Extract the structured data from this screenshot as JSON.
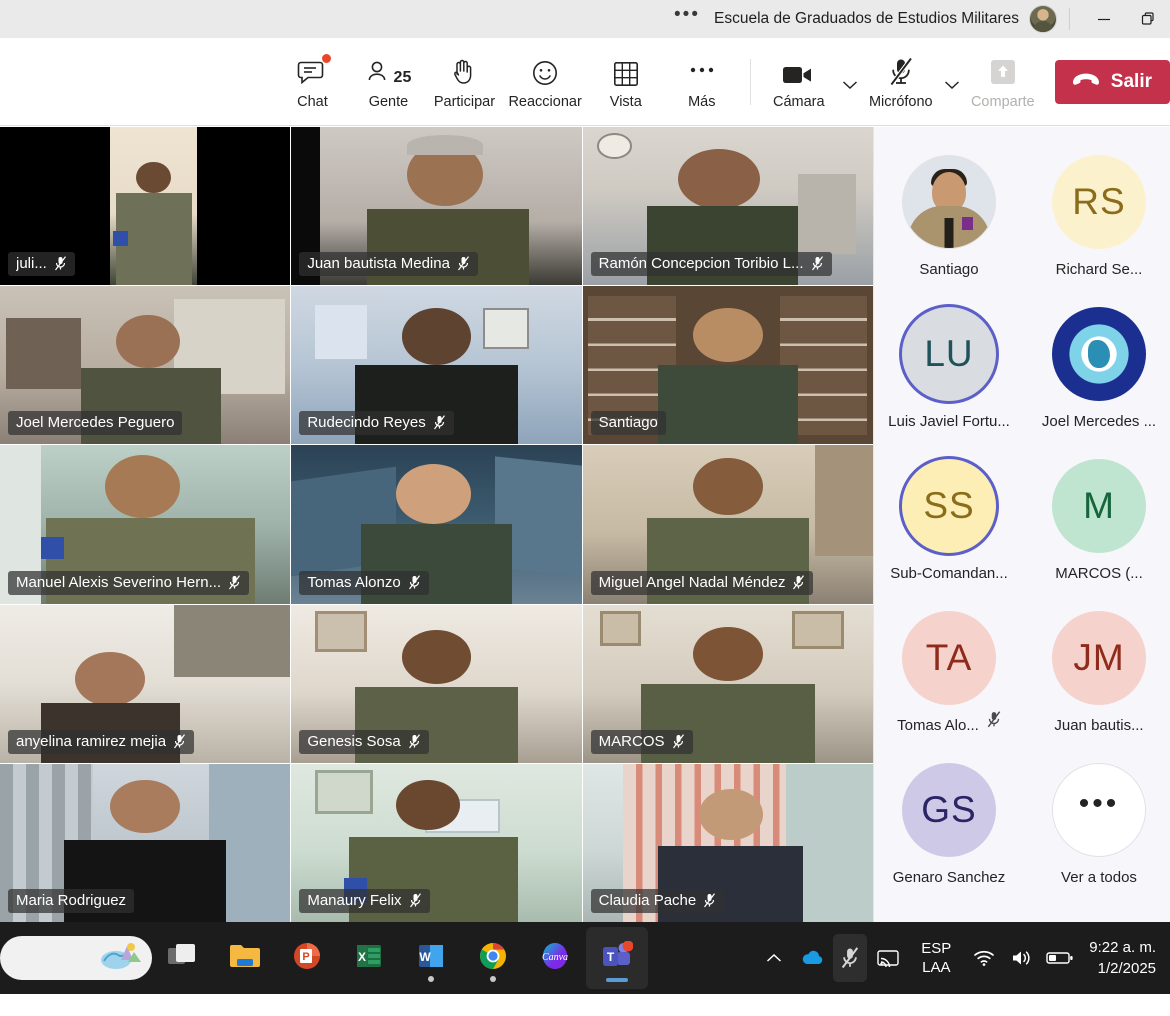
{
  "titlebar": {
    "overflow_label": "•••",
    "title": "Escuela de Graduados de Estudios Militares",
    "minimize_label": "",
    "restore_label": ""
  },
  "toolbar": {
    "items": [
      {
        "label": "Chat",
        "icon": "chat-icon",
        "badge": true
      },
      {
        "label": "Gente",
        "icon": "people-icon",
        "count": "25"
      },
      {
        "label": "Participar",
        "icon": "raise-hand-icon"
      },
      {
        "label": "Reaccionar",
        "icon": "emoji-smiley-icon"
      },
      {
        "label": "Vista",
        "icon": "grid-view-icon"
      },
      {
        "label": "Más",
        "icon": "more-ellipsis-icon"
      }
    ],
    "camera": {
      "label": "Cámara",
      "icon": "camera-icon",
      "state": "on"
    },
    "microphone": {
      "label": "Micrófono",
      "icon": "microphone-off-icon",
      "state": "muted"
    },
    "share": {
      "label": "Comparte",
      "icon": "share-screen-icon",
      "state": "disabled"
    },
    "hangup": {
      "label": "Salir",
      "icon": "hangup-phone-icon",
      "color": "#c4314b"
    }
  },
  "stage": {
    "tiles": [
      {
        "name": "juli...",
        "muted": true,
        "style": "pillar-dark"
      },
      {
        "name": "Juan bautista Medina",
        "muted": true,
        "style": "office-gray"
      },
      {
        "name": "Ramón Concepcion Toribio L...",
        "muted": true,
        "style": "office-wall"
      },
      {
        "name": "Joel Mercedes Peguero",
        "muted": false,
        "style": "living-room"
      },
      {
        "name": "Rudecindo Reyes",
        "muted": true,
        "style": "blue-room"
      },
      {
        "name": "Santiago",
        "muted": false,
        "style": "bookshelf"
      },
      {
        "name": "Manuel Alexis Severino Hern...",
        "muted": true,
        "style": "flag-room"
      },
      {
        "name": "Tomas Alonzo",
        "muted": true,
        "style": "space-bg"
      },
      {
        "name": "Miguel Angel Nadal Méndez",
        "muted": true,
        "style": "beige-room"
      },
      {
        "name": "anyelina ramirez mejia",
        "muted": true,
        "style": "white-room"
      },
      {
        "name": "Genesis Sosa",
        "muted": true,
        "style": "frames-room"
      },
      {
        "name": "MARCOS",
        "muted": true,
        "style": "picture-room"
      },
      {
        "name": "Maria Rodriguez",
        "muted": false,
        "style": "window-room"
      },
      {
        "name": "Manaury Felix",
        "muted": true,
        "style": "poster-room"
      },
      {
        "name": "Claudia Pache",
        "muted": true,
        "style": "curtain-room"
      }
    ]
  },
  "sidebar": {
    "participants": [
      {
        "name": "Santiago",
        "avatar_type": "photo",
        "initials": "",
        "bg": "#dfe3ea",
        "fg": "#2b2b2b",
        "ring": false,
        "muted": false
      },
      {
        "name": "Richard Se...",
        "avatar_type": "initials",
        "initials": "RS",
        "bg": "#fbf2cd",
        "fg": "#8a6d1a",
        "ring": false,
        "muted": false
      },
      {
        "name": "Luis Javiel Fortu...",
        "avatar_type": "initials",
        "initials": "LU",
        "bg": "#d9dde2",
        "fg": "#20525a",
        "ring": true,
        "muted": false
      },
      {
        "name": "Joel Mercedes ...",
        "avatar_type": "crest",
        "initials": "",
        "bg": "#1a2f8f",
        "fg": "#ffffff",
        "ring": false,
        "muted": false
      },
      {
        "name": "Sub-Comandan...",
        "avatar_type": "initials",
        "initials": "SS",
        "bg": "#fdeeb5",
        "fg": "#8a6d1a",
        "ring": true,
        "muted": false
      },
      {
        "name": "MARCOS (...",
        "avatar_type": "initials",
        "initials": "M",
        "bg": "#bfe5d0",
        "fg": "#16653c",
        "ring": false,
        "muted": false
      },
      {
        "name": "Tomas Alo...",
        "avatar_type": "initials",
        "initials": "TA",
        "bg": "#f6d2cc",
        "fg": "#8e2b1b",
        "ring": false,
        "muted": true
      },
      {
        "name": "Juan bautis...",
        "avatar_type": "initials",
        "initials": "JM",
        "bg": "#f6d2cc",
        "fg": "#8e2b1b",
        "ring": false,
        "muted": false
      },
      {
        "name": "Genaro Sanchez",
        "avatar_type": "initials",
        "initials": "GS",
        "bg": "#cfc9e8",
        "fg": "#2b2465",
        "ring": false,
        "muted": false
      },
      {
        "name": "Ver a todos",
        "avatar_type": "dots",
        "initials": "•••",
        "bg": "#ffffff",
        "fg": "#242424",
        "ring": false,
        "muted": false
      }
    ]
  },
  "taskbar": {
    "apps": [
      {
        "name": "start-button",
        "icon": "windows-spotlight-icon",
        "running": false
      },
      {
        "name": "task-view",
        "icon": "task-view-icon",
        "running": false
      },
      {
        "name": "file-explorer",
        "icon": "folder-icon",
        "running": false
      },
      {
        "name": "powerpoint",
        "icon": "powerpoint-icon",
        "running": false
      },
      {
        "name": "excel",
        "icon": "excel-icon",
        "running": false
      },
      {
        "name": "word",
        "icon": "word-icon",
        "running": true
      },
      {
        "name": "chrome",
        "icon": "chrome-icon",
        "running": true
      },
      {
        "name": "canva",
        "icon": "canva-icon",
        "running": false
      },
      {
        "name": "teams",
        "icon": "teams-icon",
        "running": true,
        "active": true,
        "badge": true
      }
    ],
    "tray": {
      "chevron": "show-hidden-icons",
      "onedrive": "onedrive-icon",
      "mic": "microphone-muted-icon",
      "cast": "cast-icon",
      "language_line1": "ESP",
      "language_line2": "LAA",
      "wifi": "wifi-icon",
      "volume": "volume-icon",
      "battery": "battery-icon"
    },
    "clock": {
      "time": "9:22 a. m.",
      "date": "1/2/2025"
    }
  }
}
